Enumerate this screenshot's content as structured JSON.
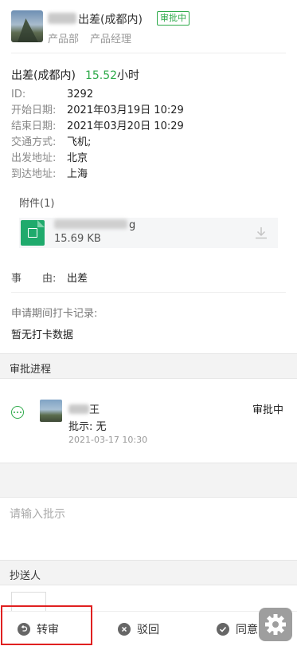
{
  "header": {
    "name_visible": "出差(成都内)",
    "status_tag": "审批中",
    "department": "产品部",
    "position": "产品经理"
  },
  "summary": {
    "type": "出差(成都内)",
    "hours": "15.52",
    "unit": "小时"
  },
  "details": [
    {
      "label": "ID:",
      "value": "3292"
    },
    {
      "label": "开始日期:",
      "value": "2021年03月19日 10:29"
    },
    {
      "label": "结束日期:",
      "value": "2021年03月20日 10:29"
    },
    {
      "label": "交通方式:",
      "value": "飞机;"
    },
    {
      "label": "出发地址:",
      "value": "北京"
    },
    {
      "label": "到达地址:",
      "value": "上海"
    }
  ],
  "attachments": {
    "title": "附件(1)",
    "file_name_suffix": "g",
    "file_size": "15.69 KB"
  },
  "reason": {
    "label": "事　　由:",
    "value": "出差"
  },
  "clock": {
    "title": "申请期间打卡记录:",
    "empty": "暂无打卡数据"
  },
  "process": {
    "section_title": "审批进程",
    "approver_name_visible": "王",
    "status": "审批中",
    "comment": "批示: 无",
    "time": "2021-03-17 10:30"
  },
  "comment_input": {
    "placeholder": "请输入批示"
  },
  "cc": {
    "section_title": "抄送人"
  },
  "actions": {
    "transfer": "转审",
    "reject": "驳回",
    "approve": "同意"
  },
  "colors": {
    "accent_green": "#2eaa4a",
    "highlight_red": "#e02020"
  }
}
